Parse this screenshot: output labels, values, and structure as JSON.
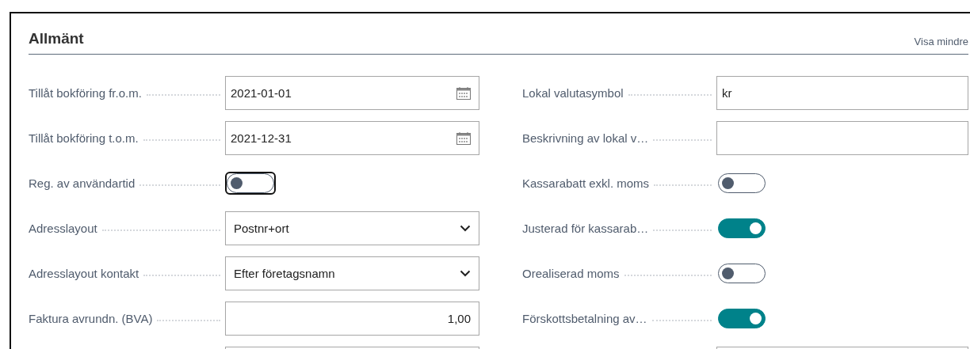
{
  "section": {
    "title": "Allmänt",
    "toggle_link": "Visa mindre"
  },
  "columns": [
    {
      "fields": [
        {
          "kind": "date",
          "label": "Tillåt bokföring fr.o.m.",
          "value": "2021-01-01"
        },
        {
          "kind": "date",
          "label": "Tillåt bokföring t.o.m.",
          "value": "2021-12-31"
        },
        {
          "kind": "toggle",
          "label": "Reg. av användartid",
          "on": false,
          "focused": true
        },
        {
          "kind": "select",
          "label": "Adresslayout",
          "value": "Postnr+ort"
        },
        {
          "kind": "select",
          "label": "Adresslayout kontakt",
          "value": "Efter företagsnamn"
        },
        {
          "kind": "number",
          "label": "Faktura avrundn. (BVA)",
          "value": "1,00"
        },
        {
          "kind": "text"
        }
      ]
    },
    {
      "fields": [
        {
          "kind": "text",
          "label": "Lokal valutasymbol",
          "value": "kr"
        },
        {
          "kind": "text",
          "label": "Beskrivning av lokal v…"
        },
        {
          "kind": "toggle",
          "label": "Kassarabatt exkl. moms",
          "on": false
        },
        {
          "kind": "toggle",
          "label": "Justerad för kassarab…",
          "on": true
        },
        {
          "kind": "toggle",
          "label": "Orealiserad moms",
          "on": false
        },
        {
          "kind": "toggle",
          "label": "Förskottsbetalning av…",
          "on": true
        },
        {
          "kind": "text"
        }
      ]
    }
  ]
}
